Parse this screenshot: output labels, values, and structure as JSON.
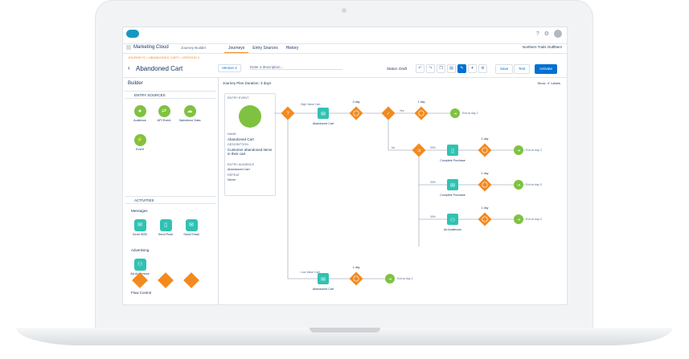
{
  "topbar": {
    "app_name": "Marketing Cloud",
    "context": "Journey Builder",
    "help_icon": "?",
    "settings_icon": "⚙"
  },
  "tabs": [
    "Journeys",
    "Entry Sources",
    "History"
  ],
  "business_unit": "Northern Trails Outfitters",
  "breadcrumb": "JOURNEYS > ABANDONED CART > VERSION 2",
  "journey": {
    "title": "Abandoned Cart",
    "version": "Version 2",
    "description_placeholder": "Enter a description...",
    "status": "Status: Draft"
  },
  "actions": {
    "save": "Save",
    "test": "Test",
    "activate": "Activate"
  },
  "sidebar": {
    "title": "Builder",
    "entry_sources_label": "ENTRY SOURCES",
    "entry_sources": [
      "Audience",
      "API Event",
      "Salesforce Data",
      "Event"
    ],
    "activities_label": "ACTIVITIES",
    "messages_label": "Messages",
    "messages": [
      "Send SMS",
      "Send Push",
      "Send Email"
    ],
    "advertising_label": "Advertising",
    "advertising": [
      "Ad Audiences"
    ],
    "flow_control_label": "Flow Control"
  },
  "canvas": {
    "plan_label": "Journey Plan",
    "duration": "Duration: 3 days",
    "show_label": "Show",
    "labels_toggle": "Labels",
    "entry_event": {
      "header": "ENTRY EVENT",
      "name_label": "NAME",
      "name": "Abandoned Cart",
      "description_label": "DESCRIPTION",
      "description": "Customer abandoned items in their cart",
      "audience_label": "ENTRY AUDIENCE",
      "audience": "Abandoned Cart",
      "repeat_label": "REPEAT",
      "repeat": "Never"
    },
    "nodes": {
      "high_value": "High Value Cart",
      "low_value": "Low Value Cart",
      "email1": "Abandoned Cart",
      "email2": "Abandoned Cart",
      "wait_2day": "2 day",
      "wait_1day": "1 day",
      "wait_1day_b": "1 day",
      "yes": "Yes",
      "no": "No",
      "exit_day2": "Exit on day 2",
      "exit_day3_1": "Exit on day 3",
      "exit_day3_2": "Exit on day 3",
      "exit_day3_3": "Exit on day 3",
      "exit_day1": "Exit on day 1",
      "split1": "33%",
      "split2": "33%",
      "split3": "34%",
      "complete1": "Complete Purchase",
      "complete2": "Complete Purchase",
      "ad_audiences": "Ad Audiences",
      "w3": "1 day",
      "w4": "1 day",
      "w5": "1 day"
    }
  },
  "colors": {
    "orange": "#f38a1f",
    "green": "#7fc241",
    "teal": "#30c2b2",
    "blue": "#0070d2",
    "line": "#aab4c2"
  }
}
